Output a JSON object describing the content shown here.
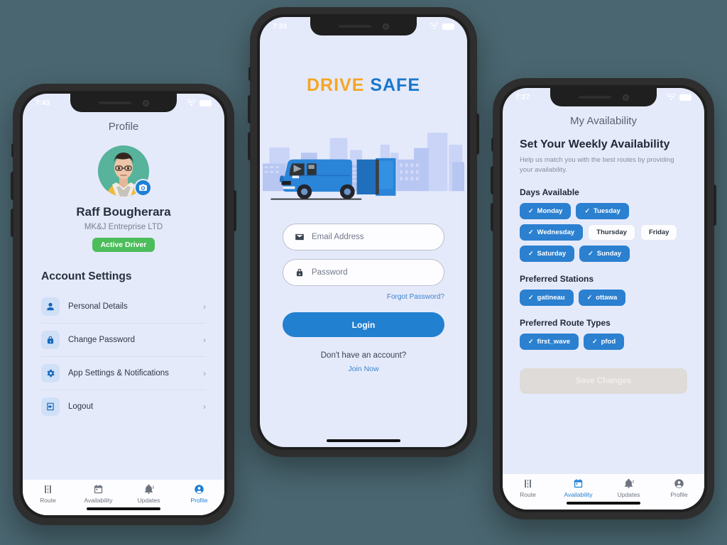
{
  "background_color": "#4a6670",
  "screen_background": "#e5eafb",
  "accent_blue": "#2b80d0",
  "accent_orange": "#f5a623",
  "status_green": "#4cbd5b",
  "phones": {
    "left": {
      "status": {
        "time": "7:43",
        "wifi_icon": "wifi-icon",
        "battery_icon": "battery-icon"
      },
      "title": "Profile",
      "avatar_icon": "avatar",
      "camera_badge_icon": "camera-icon",
      "name": "Raff Bougherara",
      "company": "MK&J Entreprise LTD",
      "badge": "Active Driver",
      "section_title": "Account Settings",
      "settings": [
        {
          "label": "Personal Details",
          "icon": "person-icon",
          "chevron": "›"
        },
        {
          "label": "Change Password",
          "icon": "lock-icon",
          "chevron": "›"
        },
        {
          "label": "App Settings & Notifications",
          "icon": "gear-icon",
          "chevron": "›"
        },
        {
          "label": "Logout",
          "icon": "logout-icon",
          "chevron": "›"
        }
      ],
      "nav": [
        {
          "label": "Route",
          "icon": "road-icon",
          "active": false
        },
        {
          "label": "Availability",
          "icon": "calendar-icon",
          "active": false
        },
        {
          "label": "Updates",
          "icon": "bell-icon",
          "active": false
        },
        {
          "label": "Profile",
          "icon": "profile-icon",
          "active": true
        }
      ]
    },
    "center": {
      "status": {
        "time": "7:24",
        "wifi_icon": "wifi-icon",
        "battery_icon": "battery-icon"
      },
      "logo_word1": "DRIVE",
      "logo_word2": "SAFE",
      "hero_icon": "delivery-van-city-illustration",
      "email": {
        "placeholder": "Email Address",
        "value": "",
        "icon": "envelope-icon"
      },
      "password": {
        "placeholder": "Password",
        "value": "",
        "icon": "lock-icon"
      },
      "forgot_password": "Forgot Password?",
      "login_label": "Login",
      "signup_question": "Don't have an account?",
      "join_label": "Join Now"
    },
    "right": {
      "status": {
        "time": "7:27",
        "wifi_icon": "wifi-icon",
        "battery_icon": "battery-icon"
      },
      "title": "My Availability",
      "heading": "Set Your Weekly Availability",
      "subtitle": "Help us match you with the best routes by providing your availability.",
      "days_title": "Days Available",
      "days": [
        {
          "label": "Monday",
          "selected": true
        },
        {
          "label": "Tuesday",
          "selected": true
        },
        {
          "label": "Wednesday",
          "selected": true
        },
        {
          "label": "Thursday",
          "selected": false
        },
        {
          "label": "Friday",
          "selected": false
        },
        {
          "label": "Saturday",
          "selected": true
        },
        {
          "label": "Sunday",
          "selected": true
        }
      ],
      "stations_title": "Preferred Stations",
      "stations": [
        {
          "label": "gatineau",
          "selected": true
        },
        {
          "label": "ottawa",
          "selected": true
        }
      ],
      "route_types_title": "Preferred Route Types",
      "route_types": [
        {
          "label": "first_wave",
          "selected": true
        },
        {
          "label": "pfod",
          "selected": true
        }
      ],
      "save_label": "Save Changes",
      "save_disabled": true,
      "nav": [
        {
          "label": "Route",
          "icon": "road-icon",
          "active": false
        },
        {
          "label": "Availability",
          "icon": "calendar-icon",
          "active": true
        },
        {
          "label": "Updates",
          "icon": "bell-icon",
          "active": false
        },
        {
          "label": "Profile",
          "icon": "profile-icon",
          "active": false
        }
      ]
    }
  },
  "icon_glyphs": {
    "check": "✓",
    "chevron_right": "›"
  }
}
